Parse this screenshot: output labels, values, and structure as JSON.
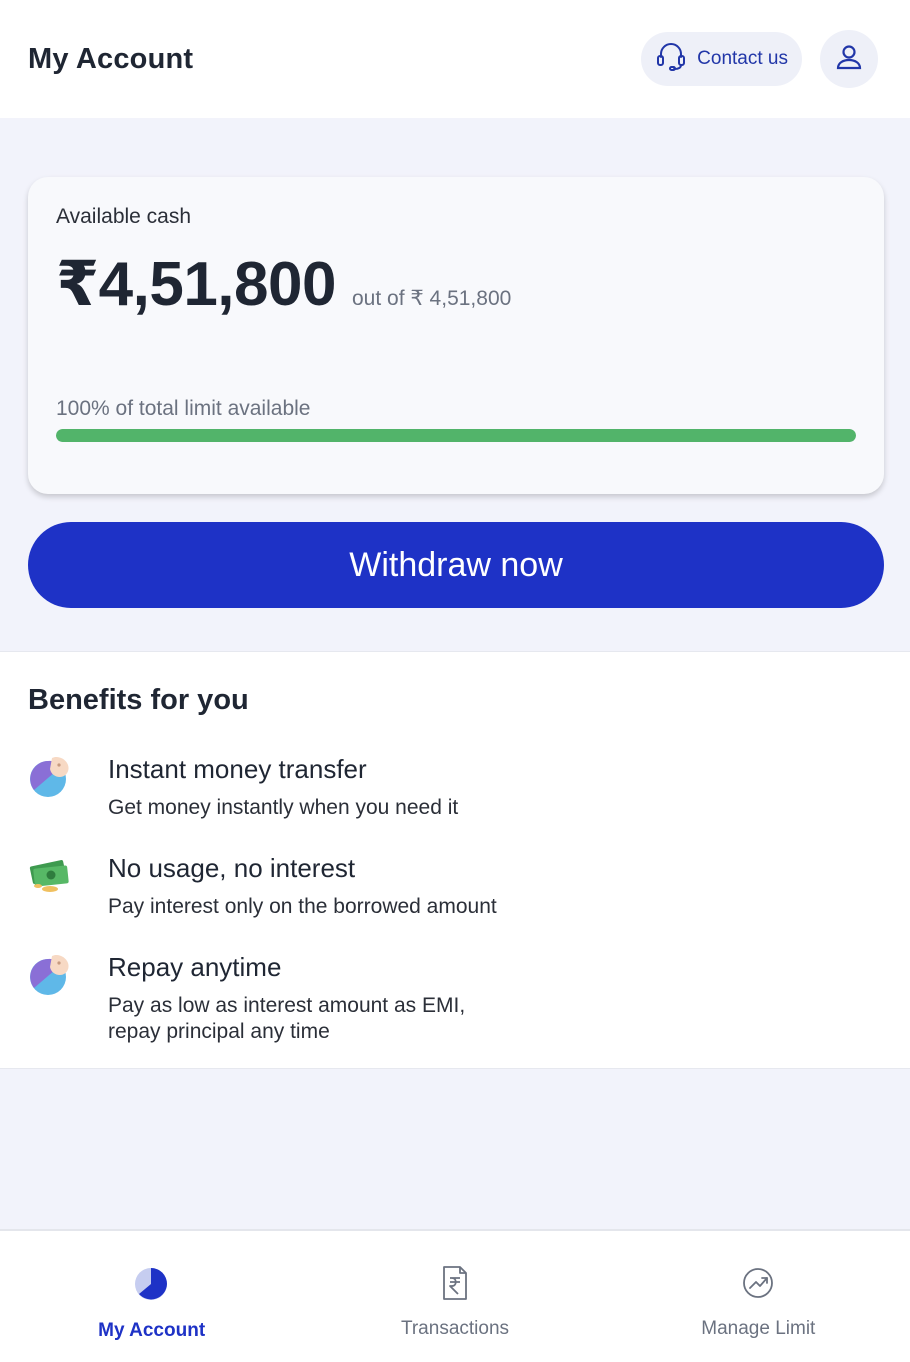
{
  "header": {
    "title": "My Account",
    "contact_label": "Contact us"
  },
  "cash_card": {
    "label": "Available cash",
    "amount": "₹4,51,800",
    "out_of": "out of ₹ 4,51,800",
    "limit_text": "100% of total limit available",
    "progress_fraction": 1.0
  },
  "withdraw_label": "Withdraw now",
  "benefits": {
    "title": "Benefits for you",
    "items": [
      {
        "title": "Instant money transfer",
        "desc": "Get money instantly when you need it",
        "icon": "piggy-bank-icon"
      },
      {
        "title": "No usage, no interest",
        "desc": "Pay interest only on the borrowed amount",
        "icon": "money-stack-icon"
      },
      {
        "title": "Repay anytime",
        "desc_lines": [
          "Pay as low as interest amount as EMI,",
          "repay principal any time"
        ],
        "icon": "piggy-bank-icon"
      }
    ]
  },
  "bottom_nav": [
    {
      "label": "My Account",
      "icon": "pie-chart-icon",
      "active": true
    },
    {
      "label": "Transactions",
      "icon": "rupee-document-icon",
      "active": false
    },
    {
      "label": "Manage Limit",
      "icon": "trend-up-icon",
      "active": false
    }
  ],
  "colors": {
    "accent": "#1e32c6",
    "progress": "#52b46a",
    "page_bg": "#f2f3fb"
  }
}
